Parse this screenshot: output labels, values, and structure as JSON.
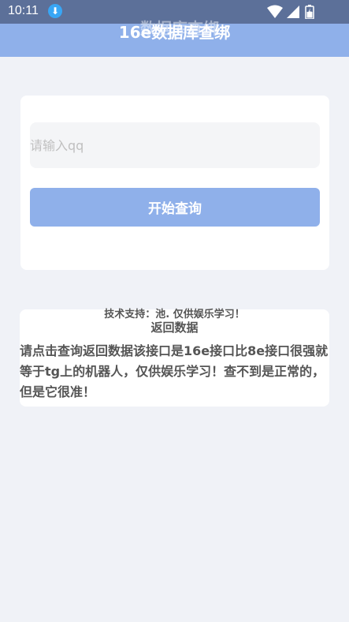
{
  "status_bar": {
    "time": "10:11",
    "download_icon": "download-arrow-icon",
    "icons": [
      "wifi-icon",
      "signal-icon",
      "battery-icon"
    ]
  },
  "app_bar": {
    "title": "16e数据库查绑",
    "ghost_title": "数据库查绑",
    "color": "#8fb0ea"
  },
  "query_card": {
    "input_placeholder": "请输入qq",
    "input_value": "",
    "button_label": "开始查询",
    "button_color": "#8fb0ea"
  },
  "support_text": "技术支持：池. 仅供娱乐学习！",
  "result_card": {
    "title": "返回数据",
    "text": "请点击查询返回数据该接口是16e接口比8e接口很强就等于tg上的机器人，仅供娱乐学习！查不到是正常的，但是它很准！"
  }
}
